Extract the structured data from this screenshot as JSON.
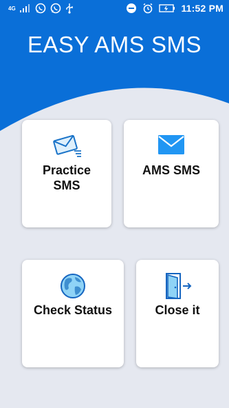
{
  "status_bar": {
    "network": "4G",
    "time": "11:52",
    "meridiem": "PM",
    "icons": [
      "signal-icon",
      "whatsapp-icon",
      "whatsapp-icon",
      "usb-icon",
      "dnd-icon",
      "alarm-icon",
      "battery-icon"
    ]
  },
  "app": {
    "title": "EASY AMS SMS"
  },
  "cards": {
    "practice": {
      "line1": "Practice",
      "line2": "SMS",
      "icon": "envelope-send-icon"
    },
    "ams": {
      "label": "AMS SMS",
      "icon": "mail-icon"
    },
    "status": {
      "label": "Check Status",
      "icon": "globe-icon"
    },
    "close": {
      "label": "Close it",
      "icon": "exit-door-icon"
    }
  },
  "colors": {
    "primary": "#0a6fd8",
    "background": "#e5e8f0",
    "card": "#ffffff",
    "text": "#111111"
  }
}
